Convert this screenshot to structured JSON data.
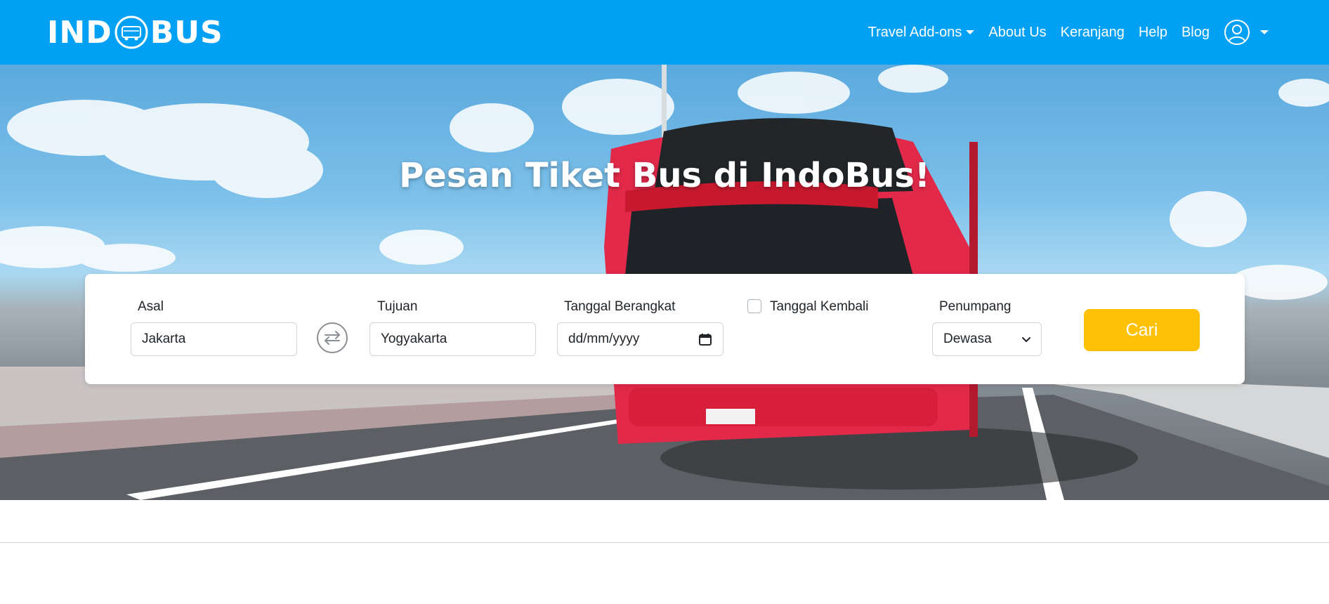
{
  "navbar": {
    "brand": {
      "left": "IND",
      "right": "BUS"
    },
    "links": [
      {
        "label": "Travel Add-ons",
        "dropdown": true
      },
      {
        "label": "About Us"
      },
      {
        "label": "Keranjang"
      },
      {
        "label": "Help"
      },
      {
        "label": "Blog"
      }
    ],
    "user_menu_icon": "user-circle-icon"
  },
  "hero": {
    "title": "Pesan Tiket Bus di IndoBus!"
  },
  "search": {
    "asal_label": "Asal",
    "asal_value": "Jakarta",
    "tujuan_label": "Tujuan",
    "tujuan_value": "Yogyakarta",
    "berangkat_label": "Tanggal Berangkat",
    "berangkat_placeholder": "dd/mm/yyyy",
    "kembali_label": "Tanggal Kembali",
    "kembali_checked": false,
    "penumpang_label": "Penumpang",
    "penumpang_value": "Dewasa",
    "submit_label": "Cari",
    "swap_icon": "swap-arrows-icon",
    "calendar_icon": "calendar-icon"
  },
  "colors": {
    "navbar": "#00a0f5",
    "button": "#ffc107",
    "bus_body": "#e3294a"
  }
}
